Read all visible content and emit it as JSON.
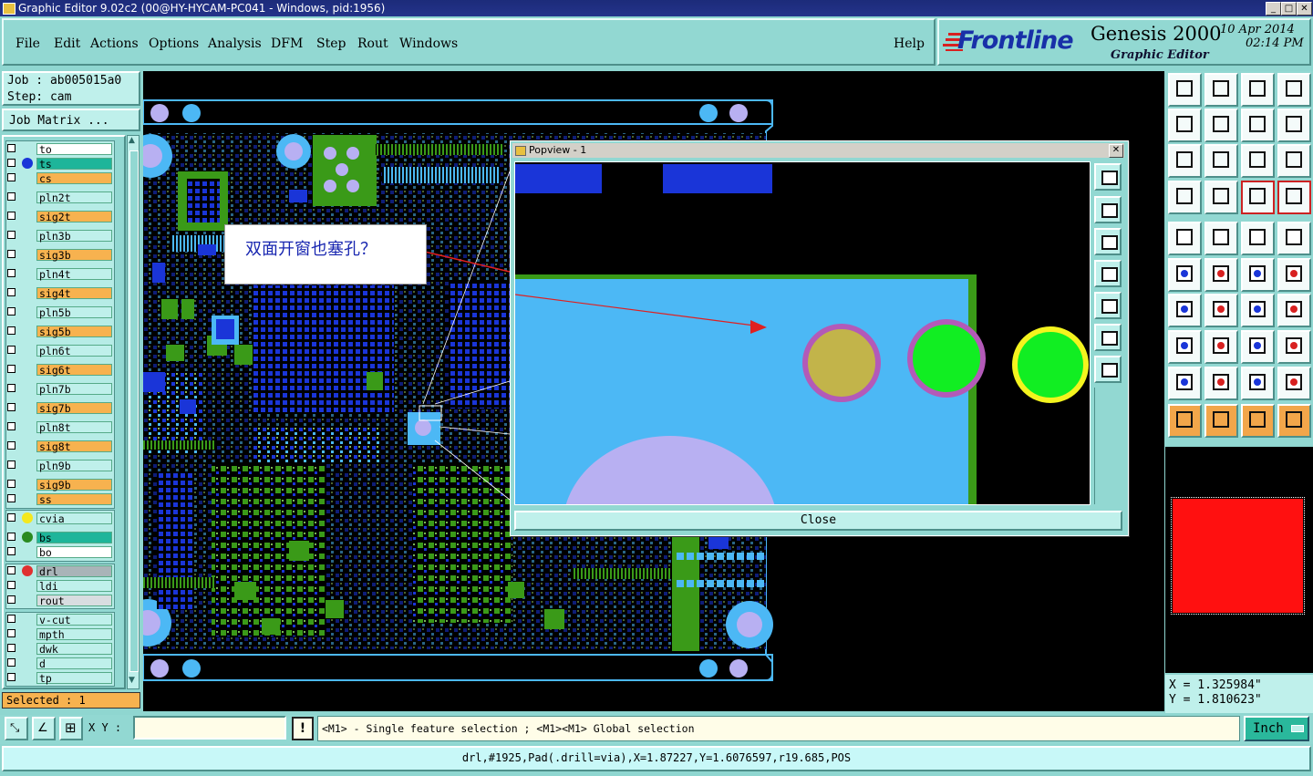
{
  "window": {
    "title": "Graphic Editor 9.02c2 (00@HY-HYCAM-PC041 - Windows, pid:1956)",
    "controls": [
      "_",
      "□",
      "✕"
    ]
  },
  "menu": [
    "File",
    "Edit",
    "Actions",
    "Options",
    "Analysis",
    "DFM",
    "Step",
    "Rout",
    "Windows"
  ],
  "help_label": "Help",
  "brand": {
    "logo": "Frontline",
    "product": "Genesis 2000",
    "subtitle": "Graphic Editor",
    "date": "10 Apr 2014",
    "time": "02:14 PM"
  },
  "job": {
    "label": "Job : ab005015a0",
    "step": "Step: cam",
    "matrix_button": "Job Matrix ..."
  },
  "layers_top": [
    {
      "name": "to",
      "bg": "#ffffff",
      "icon": ""
    },
    {
      "name": "ts",
      "bg": "#1eb59a",
      "icon": "#1a35d8"
    },
    {
      "name": "cs",
      "bg": "#f7b24f",
      "icon": ""
    },
    {
      "name": "pln2t",
      "bg": "#bff0eb",
      "icon": ""
    },
    {
      "name": "sig2t",
      "bg": "#f7b24f",
      "icon": ""
    },
    {
      "name": "pln3b",
      "bg": "#bff0eb",
      "icon": ""
    },
    {
      "name": "sig3b",
      "bg": "#f7b24f",
      "icon": ""
    },
    {
      "name": "pln4t",
      "bg": "#bff0eb",
      "icon": ""
    },
    {
      "name": "sig4t",
      "bg": "#f7b24f",
      "icon": ""
    },
    {
      "name": "pln5b",
      "bg": "#bff0eb",
      "icon": ""
    },
    {
      "name": "sig5b",
      "bg": "#f7b24f",
      "icon": ""
    },
    {
      "name": "pln6t",
      "bg": "#bff0eb",
      "icon": ""
    },
    {
      "name": "sig6t",
      "bg": "#f7b24f",
      "icon": ""
    },
    {
      "name": "pln7b",
      "bg": "#bff0eb",
      "icon": ""
    },
    {
      "name": "sig7b",
      "bg": "#f7b24f",
      "icon": ""
    },
    {
      "name": "pln8t",
      "bg": "#bff0eb",
      "icon": ""
    },
    {
      "name": "sig8t",
      "bg": "#f7b24f",
      "icon": ""
    },
    {
      "name": "pln9b",
      "bg": "#bff0eb",
      "icon": ""
    },
    {
      "name": "sig9b",
      "bg": "#f7b24f",
      "icon": ""
    },
    {
      "name": "ss",
      "bg": "#f7b24f",
      "icon": ""
    }
  ],
  "layers_mid": [
    {
      "name": "cvia",
      "bg": "#bff0eb",
      "icon": "#f4e81e"
    },
    {
      "name": "bs",
      "bg": "#1eb59a",
      "icon": "#2a8a20"
    },
    {
      "name": "bo",
      "bg": "#ffffff",
      "icon": ""
    }
  ],
  "layers_drill": [
    {
      "name": "drl",
      "bg": "#a9b4b8",
      "icon": "#e03030"
    },
    {
      "name": "ldi",
      "bg": "#bff0eb",
      "icon": ""
    },
    {
      "name": "rout",
      "bg": "#d8dde0",
      "icon": ""
    }
  ],
  "layers_misc": [
    {
      "name": "v-cut",
      "bg": "#bff0eb",
      "icon": ""
    },
    {
      "name": "mpth",
      "bg": "#bff0eb",
      "icon": ""
    },
    {
      "name": "dwk",
      "bg": "#bff0eb",
      "icon": ""
    },
    {
      "name": "d",
      "bg": "#bff0eb",
      "icon": ""
    },
    {
      "name": "tp",
      "bg": "#bff0eb",
      "icon": ""
    }
  ],
  "selected": "Selected : 1",
  "annotation": "双面开窗也塞孔？",
  "popview": {
    "title": "Popview - 1",
    "close_label": "Close",
    "close_x": "✕"
  },
  "coords": {
    "x": "X = 1.325984\"",
    "y": "Y = 1.810623\""
  },
  "bottom": {
    "xy_label": "X Y :",
    "xy_value": "",
    "warn": "!",
    "hint": "<M1> - Single feature selection ; <M1><M1> Global selection",
    "unit": "Inch"
  },
  "info": "drl,#1925,Pad(.drill=via),X=1.87227,Y=1.6076597,r19.685,POS",
  "colors": {
    "board_bg": "#000000",
    "copper_blue": "#1a35d8",
    "green": "#3a9a18",
    "light_blue": "#4cb8f5",
    "pad_green": "#11ee22",
    "pad_olive": "#c2b44a",
    "ring_purple": "#b35ab8",
    "ring_yellow": "#f4f41e",
    "lavender": "#b8b0f2",
    "preview_red": "#ff1010"
  }
}
